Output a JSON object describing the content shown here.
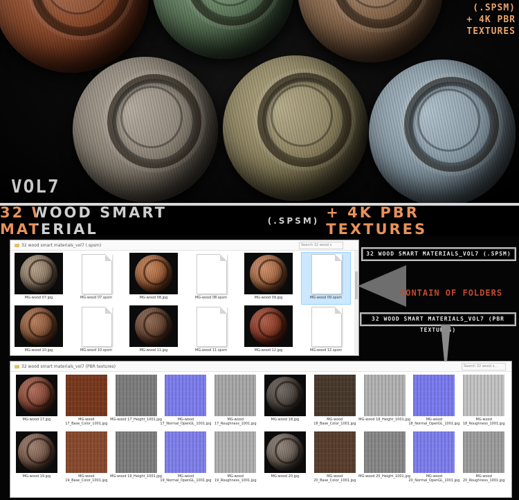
{
  "hero": {
    "brand_lines": [
      "(.SPSM)",
      "+ 4K PBR",
      "TEXTURES"
    ],
    "vol_label": "VOL7",
    "spheres": [
      {
        "name": "top-left-sphere",
        "color": "#8a4a2c"
      },
      {
        "name": "top-middle-sphere",
        "color": "#5f7a5c"
      },
      {
        "name": "top-right-sphere",
        "color": "#8a6a4e"
      },
      {
        "name": "bottom-left-sphere",
        "color": "#8c8376"
      },
      {
        "name": "bottom-middle-sphere",
        "color": "#8d8360"
      },
      {
        "name": "bottom-right-sphere",
        "color": "#8799a4"
      }
    ]
  },
  "title": {
    "part1": "32 WOOD SMART MATERIAL",
    "part2": "(.SPSM)",
    "part3": "+ 4K PBR TEXTURES"
  },
  "window1": {
    "path": "32 wood smart materials_vol7 (.spsm)",
    "search": "Search 32 wood s",
    "files": [
      {
        "caption": "MG-wood 07.jpg",
        "kind": "sphere",
        "color": "#8e7b66"
      },
      {
        "caption": "MG-wood 07.spsm",
        "kind": "doc"
      },
      {
        "caption": "MG-wood 08.jpg",
        "kind": "sphere",
        "color": "#a0613a"
      },
      {
        "caption": "MG-wood 08.spsm",
        "kind": "doc"
      },
      {
        "caption": "MG-wood 09.jpg",
        "kind": "sphere",
        "color": "#a86a45"
      },
      {
        "caption": "MG-wood 09.spsm",
        "kind": "doc",
        "selected": true
      },
      {
        "caption": "MG-wood 10.jpg",
        "kind": "sphere",
        "color": "#8f5a3a"
      },
      {
        "caption": "MG-wood 10.spsm",
        "kind": "doc"
      },
      {
        "caption": "MG-wood 11.jpg",
        "kind": "sphere",
        "color": "#6a4632"
      },
      {
        "caption": "MG-wood 11.spsm",
        "kind": "doc"
      },
      {
        "caption": "MG-wood 12.jpg",
        "kind": "sphere",
        "color": "#8a3a26"
      },
      {
        "caption": "MG-wood 12.spsm",
        "kind": "doc"
      }
    ]
  },
  "callouts": {
    "spsm": "32 WOOD SMART MATERIALS_VOL7 (.SPSM)",
    "contain": "CONTAIN OF FOLDERS",
    "pbr": "32 WOOD SMART MATERIALS_VOL7 (PBR TEXTURES)"
  },
  "window2": {
    "path": "32 wood smart materials_vol7 (PBR textures)",
    "search": "Search 32 wood s...",
    "rows": [
      [
        {
          "caption": "MG-wood 17.jpg",
          "kind": "sphere",
          "color": "#8a4a38"
        },
        {
          "caption": "MG-wood\n17_Base_Color_1001.jpg",
          "kind": "tex",
          "color": "#7a3a1f"
        },
        {
          "caption": "MG-wood 17_Height_1001.jpg",
          "kind": "tex",
          "color": "#7f7f7f"
        },
        {
          "caption": "MG-wood\n17_Normal_OpenGL_1001.jpg",
          "kind": "tex",
          "color": "#7f7ff0"
        },
        {
          "caption": "MG-wood\n17_Roughness_1001.jpg",
          "kind": "tex",
          "color": "#a9a9a9"
        },
        {
          "caption": "MG-wood 18.jpg",
          "kind": "sphere",
          "color": "#4d4640"
        },
        {
          "caption": "MG-wood\n18_Base_Color_1001.jpg",
          "kind": "tex",
          "color": "#4a3a2e"
        },
        {
          "caption": "MG-wood 18_Height_1001.jpg",
          "kind": "tex",
          "color": "#b4b4b4"
        },
        {
          "caption": "MG-wood\n18_Normal_OpenGL_1001.jpg",
          "kind": "tex",
          "color": "#7c7cf2"
        },
        {
          "caption": "MG-wood\n18_Roughness_1001.jpg",
          "kind": "tex",
          "color": "#c4c4c4"
        }
      ],
      [
        {
          "caption": "MG-wood 19.jpg",
          "kind": "sphere",
          "color": "#7a5c4c"
        },
        {
          "caption": "MG-wood\n19_Base_Color_1001.jpg",
          "kind": "tex",
          "color": "#8a4c30"
        },
        {
          "caption": "MG-wood 19_Height_1001.jpg",
          "kind": "tex",
          "color": "#808080"
        },
        {
          "caption": "MG-wood\n19_Normal_OpenGL_1001.jpg",
          "kind": "tex",
          "color": "#8282ee"
        },
        {
          "caption": "MG-wood\n19_Roughness_1001.jpg",
          "kind": "tex",
          "color": "#b0b0b0"
        },
        {
          "caption": "MG-wood 20.jpg",
          "kind": "sphere",
          "color": "#6a6058"
        },
        {
          "caption": "MG-wood\n20_Base_Color_1001.jpg",
          "kind": "tex",
          "color": "#5a4030"
        },
        {
          "caption": "MG-wood 20_Height_1001.jpg",
          "kind": "tex",
          "color": "#8a8a8a"
        },
        {
          "caption": "MG-wood\n20_Normal_OpenGL_1001.jpg",
          "kind": "tex",
          "color": "#8080ef"
        },
        {
          "caption": "MG-wood\n20_Roughness_1001.jpg",
          "kind": "tex",
          "color": "#9e9e9e"
        }
      ]
    ]
  }
}
